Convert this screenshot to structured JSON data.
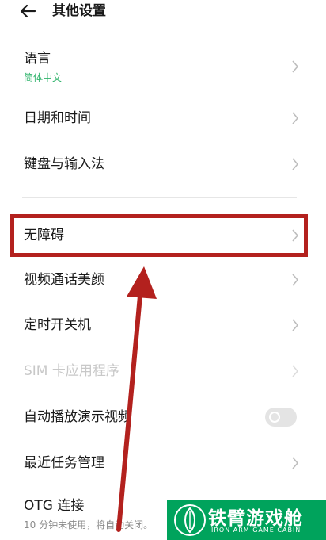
{
  "header": {
    "title": "其他设置",
    "back_icon": "arrow-left-icon"
  },
  "items": {
    "language": {
      "label": "语言",
      "value": "简体中文"
    },
    "datetime": {
      "label": "日期和时间"
    },
    "keyboard": {
      "label": "键盘与输入法"
    },
    "accessibility": {
      "label": "无障碍"
    },
    "video_call_beauty": {
      "label": "视频通话美颜"
    },
    "scheduled_power": {
      "label": "定时开关机"
    },
    "sim_apps": {
      "label": "SIM 卡应用程序",
      "disabled": true
    },
    "autoplay_demo": {
      "label": "自动播放演示视频",
      "toggle_on": false
    },
    "recent_tasks": {
      "label": "最近任务管理"
    },
    "otg": {
      "label": "OTG 连接",
      "description": "10 分钟未使用，将自动关闭。"
    }
  },
  "annotation": {
    "highlight_color": "#b3211e",
    "arrow_color": "#b3211e"
  },
  "watermark": {
    "title": "铁臂游戏舱",
    "subtitle": "IRON ARM GAME CABIN",
    "color": "#00a35c"
  },
  "colors": {
    "accent": "#2fb36b",
    "text": "#1a1a1a",
    "disabled": "#c8c8c8",
    "chevron": "#bdbdbd"
  }
}
